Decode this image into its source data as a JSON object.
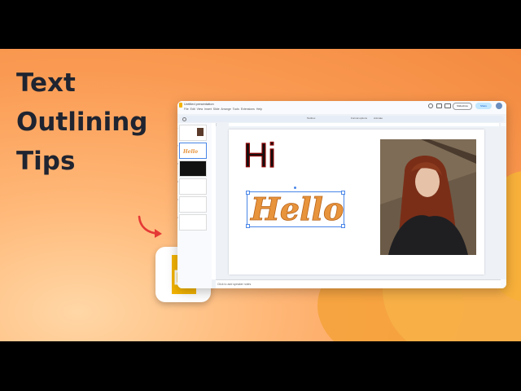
{
  "headline": {
    "line1": "Text",
    "line2": "Outlining",
    "line3": "Tips"
  },
  "app": {
    "doc_title": "Untitled presentation",
    "menu": [
      "File",
      "Edit",
      "View",
      "Insert",
      "Slide",
      "Arrange",
      "Tools",
      "Extensions",
      "Help"
    ],
    "slideshow_label": "Slideshow",
    "share_label": "Share",
    "toolbar_items": [
      "Textbox",
      "Format options",
      "Animate"
    ],
    "speaker_notes_placeholder": "Click to add speaker notes"
  },
  "slide": {
    "hi_text": "Hi",
    "hello_text": "Hello"
  },
  "thumbnails": [
    {
      "num": "1",
      "text": ""
    },
    {
      "num": "2",
      "text": "Hello"
    },
    {
      "num": "3",
      "text": ""
    },
    {
      "num": "4",
      "text": ""
    },
    {
      "num": "5",
      "text": ""
    },
    {
      "num": "6",
      "text": ""
    }
  ],
  "colors": {
    "bg_orange": "#f79a4e",
    "headline": "#1f2430",
    "hello_fill": "#e8943d",
    "arrow": "#e53935",
    "google_slides_yellow": "#f4b400",
    "selection_blue": "#4a86e8"
  },
  "icons": [
    "google-slides-icon",
    "red-arrow-icon",
    "comment-icon",
    "video-icon",
    "account-icon"
  ]
}
